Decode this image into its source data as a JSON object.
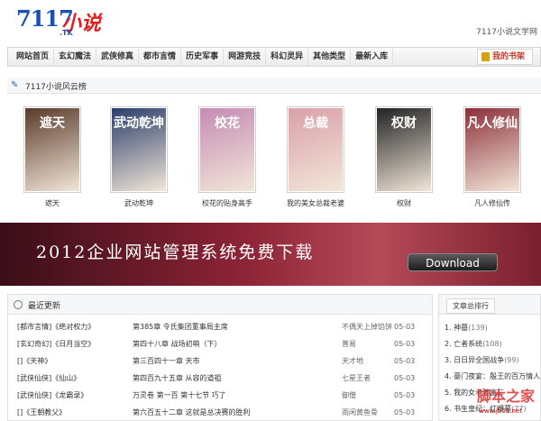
{
  "header": {
    "logo": "7117",
    "logo_zh": "小说",
    "logo_sub": ".TK",
    "site_name": "7117小说文学网"
  },
  "nav": {
    "items": [
      "网站首页",
      "玄幻魔法",
      "武侠修真",
      "都市言情",
      "历史军事",
      "网游竞技",
      "科幻灵异",
      "其他类型",
      "最新入库"
    ],
    "bookshelf": "我的书架"
  },
  "featured": {
    "title": "7117小说风云榜",
    "books": [
      {
        "title": "遮天",
        "cover_text": "遮天",
        "color": "#5a3b2a"
      },
      {
        "title": "武动乾坤",
        "cover_text": "武动乾坤",
        "color": "#2b3e6b"
      },
      {
        "title": "校花的贴身高手",
        "cover_text": "校花",
        "color": "#c58bb3"
      },
      {
        "title": "我的美女总裁老婆",
        "cover_text": "总裁",
        "color": "#d9a0a8"
      },
      {
        "title": "权财",
        "cover_text": "权财",
        "color": "#222222"
      },
      {
        "title": "凡人修仙传",
        "cover_text": "凡人修仙",
        "color": "#8c2f3a"
      }
    ]
  },
  "banner": {
    "text": "2012企业网站管理系统免费下载",
    "button": "Download"
  },
  "latest": {
    "title": "最近更新",
    "rows": [
      {
        "name": "[都市言情]《绝对权力》",
        "chapter": "第385章 令氏集团董事局主席",
        "author": "不偶天上掉馅饼",
        "date": "05-03"
      },
      {
        "name": "[玄幻奇幻]《日月当空》",
        "chapter": "第四十八章 战场初萌（下）",
        "author": "普易",
        "date": "05-03"
      },
      {
        "name": "[]《天神》",
        "chapter": "第三百四十一章 天市",
        "author": "天才地",
        "date": "05-03"
      },
      {
        "name": "[武侠仙侠]《仙山》",
        "chapter": "第四百九十五章 从容的道祖",
        "author": "七星王者",
        "date": "05-03"
      },
      {
        "name": "[武侠仙侠]《龙霸录》",
        "chapter": "万灵卷 第一百 第十七节 巧了",
        "author": "御僧",
        "date": "05-03"
      },
      {
        "name": "[]《王朝教父》",
        "chapter": "第六百五十二章 这就是总决赛的胜利",
        "author": "雨闲黄鱼骨",
        "date": "05-03"
      }
    ]
  },
  "ranking": {
    "tab": "文章总排行",
    "items": [
      {
        "label": "1. 神墓",
        "count": "(139)"
      },
      {
        "label": "2. 亡者系统",
        "count": "(108)"
      },
      {
        "label": "3. 日日异全国战争",
        "count": "(99)"
      },
      {
        "label": "4. 豪门夜宴：殷王的百万情人",
        "count": ""
      },
      {
        "label": "5. 我的女老婆富三",
        "count": ""
      },
      {
        "label": "6. 书生皇纪：红暖暮",
        "count": "(77)"
      }
    ],
    "watermark": "脚本之家",
    "watermark_sub": "www.jb51.net"
  }
}
